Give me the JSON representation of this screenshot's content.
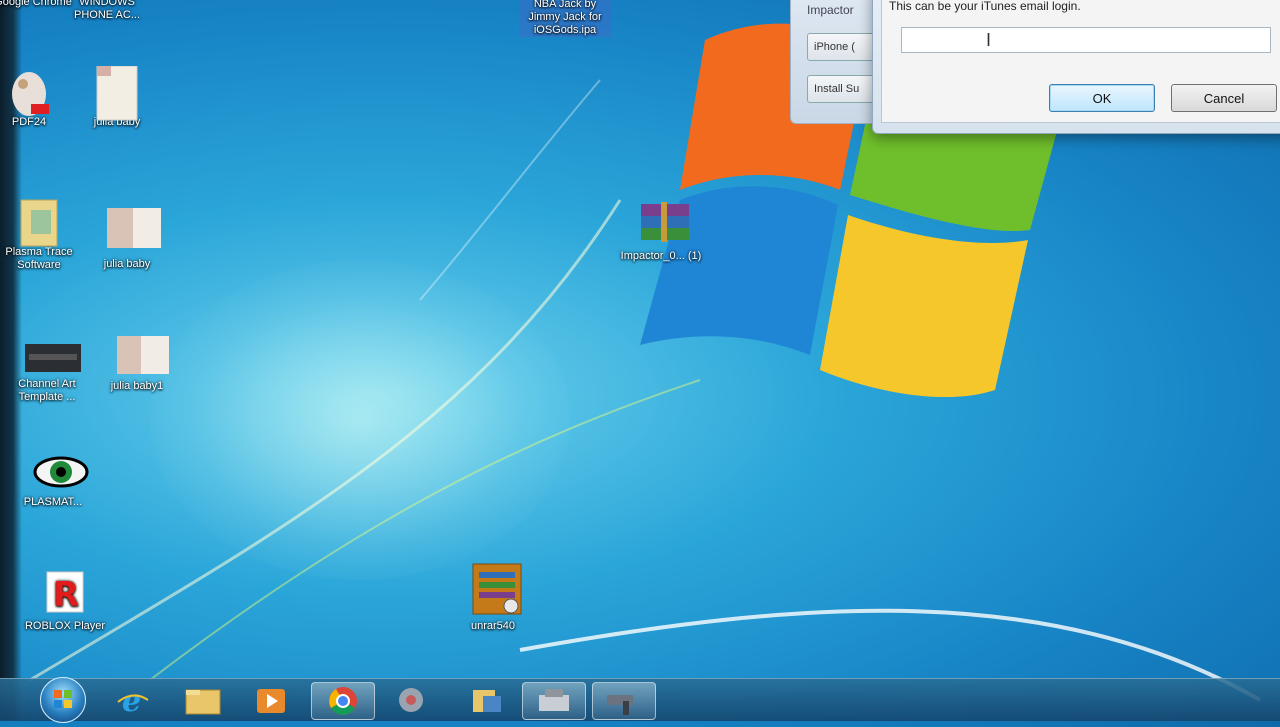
{
  "desktop": {
    "icons": [
      {
        "label": "Google Chrome"
      },
      {
        "label": "WINDOWS PHONE AC..."
      },
      {
        "label": "PDF24"
      },
      {
        "label": "julia baby"
      },
      {
        "label": "Plasma Trace Software"
      },
      {
        "label": "julia baby"
      },
      {
        "label": "Channel Art Template ..."
      },
      {
        "label": "julia baby1"
      },
      {
        "label": "PLASMAT..."
      },
      {
        "label": "ROBLOX Player"
      },
      {
        "label": "Impactor_0... (1)"
      },
      {
        "label": "unrar540"
      },
      {
        "label": "NBA Jack by Jimmy Jack for iOSGods.ipa"
      }
    ]
  },
  "dialog_back": {
    "title": "Impactor",
    "device_label": "iPhone (",
    "install_label": "Install Su"
  },
  "dialog": {
    "prompt": "This can be your iTunes email login.",
    "input_value": "",
    "ok_label": "OK",
    "cancel_label": "Cancel"
  },
  "taskbar": {
    "buttons": [
      "start-orb",
      "internet-explorer-icon",
      "file-explorer-icon",
      "media-player-icon",
      "chrome-icon",
      "app-icon",
      "app-icon-2",
      "app-icon-3",
      "app-icon-4"
    ]
  }
}
